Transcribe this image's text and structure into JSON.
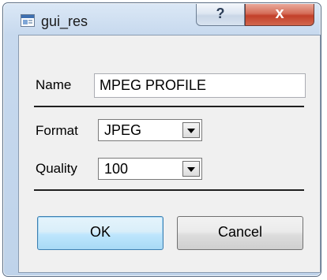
{
  "window": {
    "title": "gui_res",
    "help_glyph": "?",
    "close_glyph": "x"
  },
  "form": {
    "name_label": "Name",
    "name_value": "MPEG PROFILE",
    "format_label": "Format",
    "format_value": "JPEG",
    "quality_label": "Quality",
    "quality_value": "100"
  },
  "buttons": {
    "ok_label": "OK",
    "cancel_label": "Cancel"
  },
  "colors": {
    "titlebar_glass": "#c7d9ee",
    "close_button": "#c2402a",
    "default_button_border": "#3c7fb1",
    "dialog_face": "#f0f0f0"
  },
  "icons": {
    "app": "app-window-icon",
    "help": "help-icon",
    "close": "close-icon",
    "dropdown": "chevron-down-icon"
  }
}
